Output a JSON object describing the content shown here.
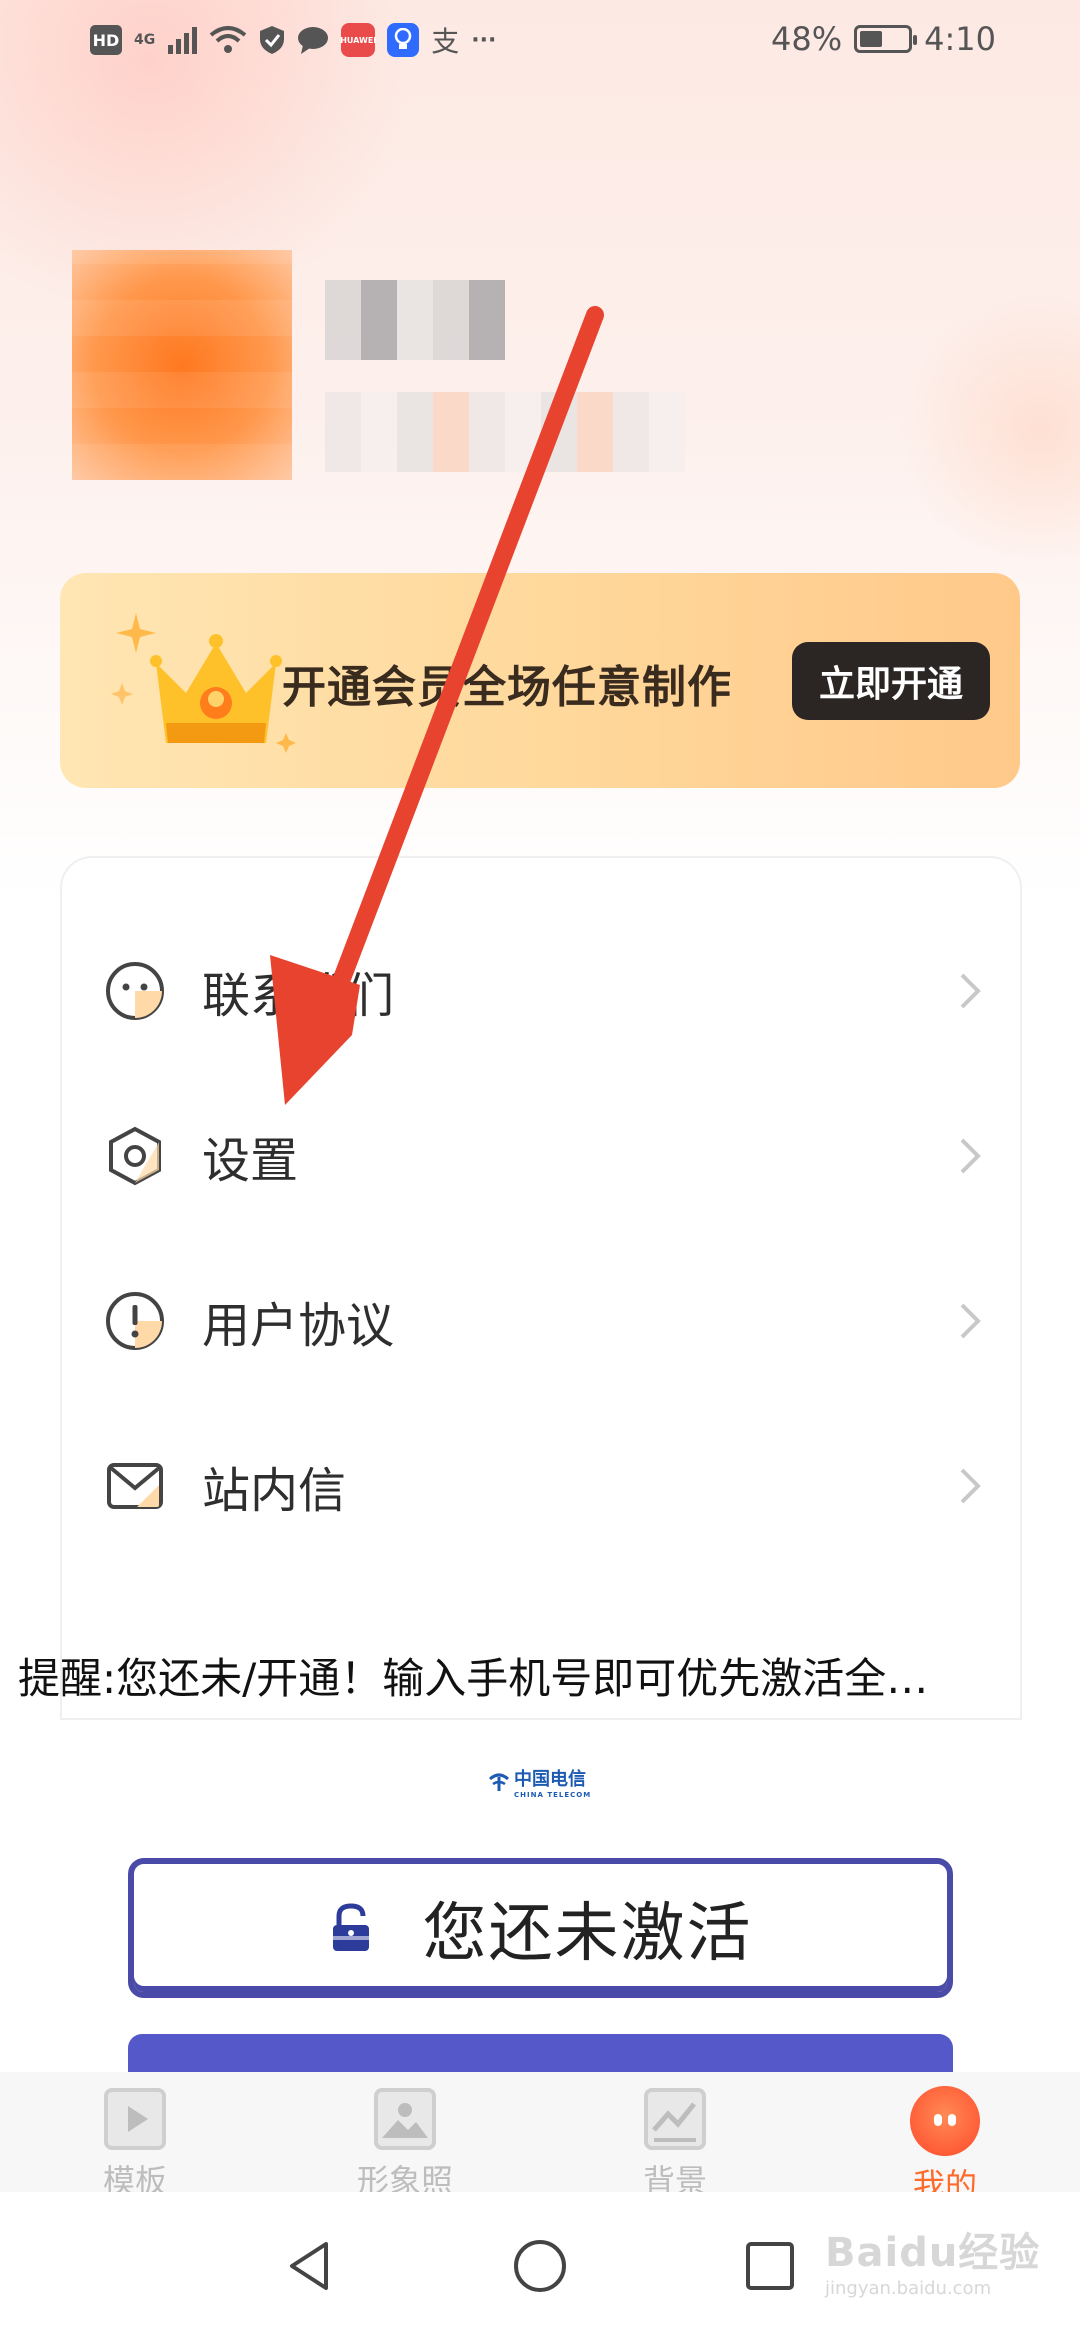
{
  "status_bar": {
    "left_icons": [
      "HD",
      "4G",
      "signal",
      "wifi",
      "shield",
      "message",
      "huawei-app",
      "bulb-app",
      "alipay",
      "more"
    ],
    "hd_label": "HD",
    "network_label": "4G",
    "alipay_label": "支",
    "more_label": "···",
    "battery_percent": "48%",
    "battery_level": 0.48,
    "time": "4:10"
  },
  "vip_banner": {
    "text": "开通会员全场任意制作",
    "button_label": "立即开通"
  },
  "menu": {
    "items": [
      {
        "label": "联系我们",
        "icon": "contact-face-icon"
      },
      {
        "label": "设置",
        "icon": "settings-hexagon-icon"
      },
      {
        "label": "用户协议",
        "icon": "agreement-exclamation-icon"
      },
      {
        "label": "站内信",
        "icon": "mail-icon"
      }
    ]
  },
  "reminder": {
    "text": "提醒:您还未/开通！输入手机号即可优先激活全…"
  },
  "telecom": {
    "name": "中国电信",
    "english": "CHINA TELECOM"
  },
  "activate": {
    "label": "您还未激活"
  },
  "bottom_nav": {
    "items": [
      {
        "label": "模板",
        "icon": "template-play-icon",
        "active": false
      },
      {
        "label": "形象照",
        "icon": "portrait-image-icon",
        "active": false
      },
      {
        "label": "背景",
        "icon": "background-image-icon",
        "active": false
      },
      {
        "label": "我的",
        "icon": "mine-face-icon",
        "active": true
      }
    ]
  },
  "watermark": {
    "brand": "Baidu经验",
    "site": "jingyan.baidu.com"
  },
  "colors": {
    "accent_orange": "#ff6b2b",
    "vip_banner": "#ffd79a",
    "activate_border": "#4a4aa8",
    "annotation_arrow": "#e8432f"
  }
}
